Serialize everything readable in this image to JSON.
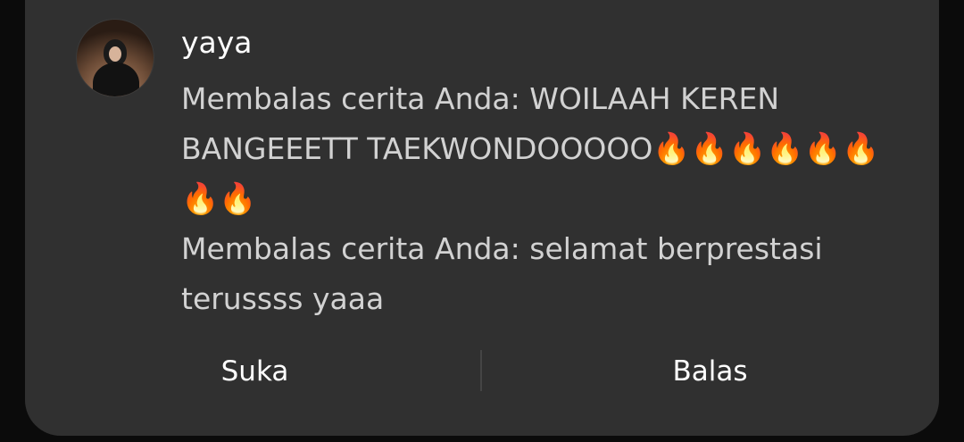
{
  "notification": {
    "sender_name": "yaya",
    "messages": [
      {
        "text": "Membalas cerita Anda: WOILAAH KEREN BANGEEETT TAEKWONDOOOOO",
        "emoji": "🔥🔥🔥🔥🔥🔥🔥🔥"
      },
      {
        "text": "Membalas cerita Anda: selamat berprestasi terussss yaaa"
      }
    ],
    "actions": {
      "like_label": "Suka",
      "reply_label": "Balas"
    }
  },
  "colors": {
    "card_background": "#303030",
    "page_background": "#0b0b0b",
    "name_text": "#ffffff",
    "message_text": "#d2d2d2"
  },
  "icons": {
    "emoji": "fire-emoji",
    "avatar": "user-avatar-photo"
  }
}
